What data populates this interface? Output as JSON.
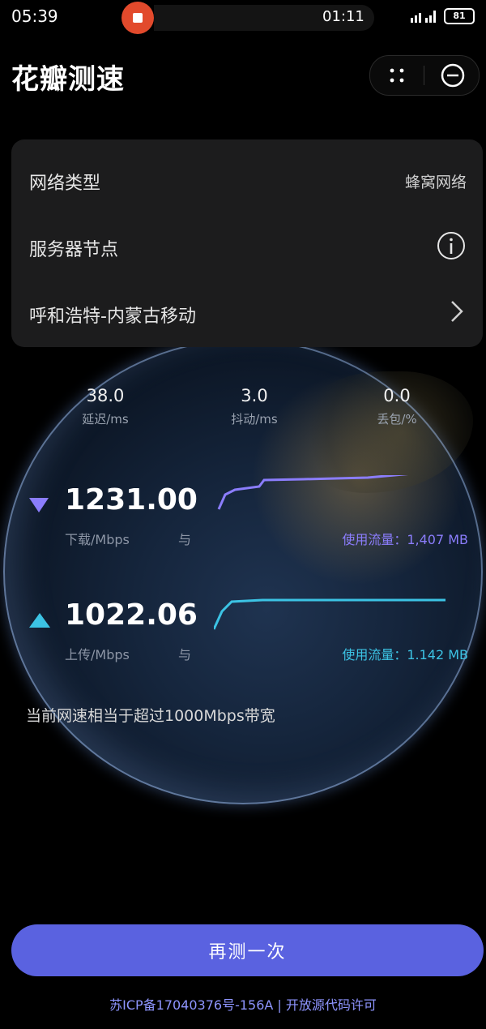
{
  "status_bar": {
    "time": "05:39",
    "record_timer": "01:11",
    "battery": "81"
  },
  "header": {
    "title": "花瓣测速"
  },
  "info_card": {
    "network_type_label": "网络类型",
    "network_type_value": "蜂窝网络",
    "server_node_label": "服务器节点",
    "server_node_value": "呼和浩特-内蒙古移动"
  },
  "metrics": {
    "latency": {
      "value": "38.0",
      "label": "延迟/ms"
    },
    "jitter": {
      "value": "3.0",
      "label": "抖动/ms"
    },
    "packet_loss": {
      "value": "0.0",
      "label": "丢包/%"
    }
  },
  "download": {
    "speed": "1231.00",
    "unit": "下载/Mbps",
    "glyph": "与",
    "usage": "使用流量：1,407 MB",
    "color": "#8b7dfc"
  },
  "upload": {
    "speed": "1022.06",
    "unit": "上传/Mbps",
    "glyph": "与",
    "usage": "使用流量：1.142 MB",
    "color": "#3cc3e4"
  },
  "note": "当前网速相当于超过1000Mbps带宽",
  "footer": {
    "retest_label": "再测一次",
    "icp": "苏ICP备17040376号-156A | 开放源代码许可"
  }
}
